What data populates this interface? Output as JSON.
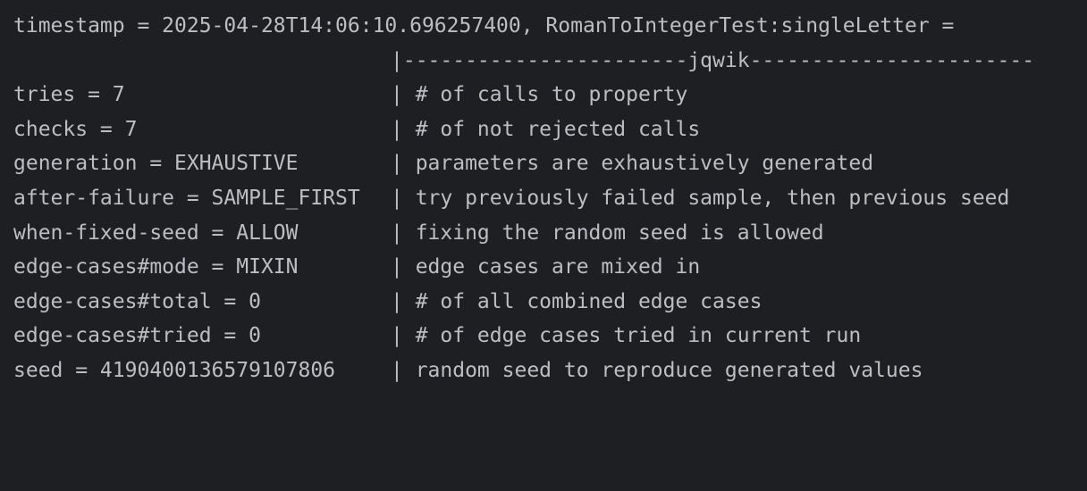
{
  "console": {
    "header": "timestamp = 2025-04-28T14:06:10.696257400, RomanToIntegerTest:singleLetter =",
    "separator": "|-----------------------jqwik-----------------------",
    "rows": [
      {
        "key": "tries = 7",
        "desc": "| # of calls to property"
      },
      {
        "key": "checks = 7",
        "desc": "| # of not rejected calls"
      },
      {
        "key": "generation = EXHAUSTIVE",
        "desc": "| parameters are exhaustively generated"
      },
      {
        "key": "after-failure = SAMPLE_FIRST",
        "desc": "| try previously failed sample, then previous seed"
      },
      {
        "key": "when-fixed-seed = ALLOW",
        "desc": "| fixing the random seed is allowed"
      },
      {
        "key": "edge-cases#mode = MIXIN",
        "desc": "| edge cases are mixed in"
      },
      {
        "key": "edge-cases#total = 0",
        "desc": "| # of all combined edge cases"
      },
      {
        "key": "edge-cases#tried = 0",
        "desc": "| # of edge cases tried in current run"
      },
      {
        "key": "seed = 4190400136579107806",
        "desc": "| random seed to reproduce generated values"
      }
    ]
  }
}
